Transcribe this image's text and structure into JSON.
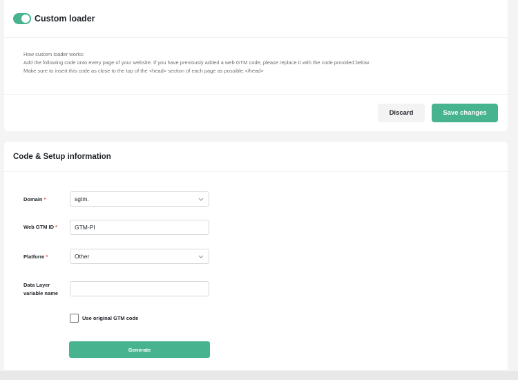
{
  "loader_card": {
    "title": "Custom loader",
    "toggle_on": true,
    "info_lines": [
      "How custom loader works:",
      "Add the following code onto every page of your website. If you have previously added a web GTM code, please replace it with the code provided below.",
      "Make sure to insert this code as close to the top of the <head> section of each page as possible.</head>"
    ],
    "discard_label": "Discard",
    "save_label": "Save changes"
  },
  "setup_card": {
    "title": "Code & Setup information",
    "domain_label": "Domain",
    "domain_value": "sgtm.",
    "gtm_label": "Web GTM ID",
    "gtm_value": "GTM-PI",
    "platform_label": "Platform",
    "platform_value": "Other",
    "datalayer_label_line1": "Data Layer",
    "datalayer_label_line2": "variable name",
    "datalayer_value": "",
    "required_marker": "*",
    "checkbox_label": "Use original GTM code",
    "checkbox_checked": false,
    "generate_label": "Generate"
  },
  "colors": {
    "accent": "#48b38f",
    "required": "#e0523c"
  }
}
